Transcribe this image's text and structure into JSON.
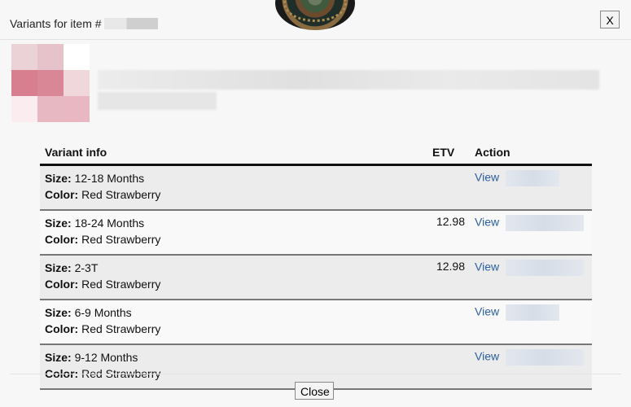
{
  "dialog": {
    "title": "Variants for item #",
    "close_x_label": "X",
    "close_label": "Close"
  },
  "table": {
    "headers": [
      "Variant info",
      "ETV",
      "Action"
    ],
    "size_label": "Size:",
    "color_label": "Color:",
    "rows": [
      {
        "size": "12-18 Months",
        "color": "Red Strawberry",
        "etv": "",
        "action": "View"
      },
      {
        "size": "18-24 Months",
        "color": "Red Strawberry",
        "etv": "12.98",
        "action": "View"
      },
      {
        "size": "2-3T",
        "color": "Red Strawberry",
        "etv": "12.98",
        "action": "View"
      },
      {
        "size": "6-9 Months",
        "color": "Red Strawberry",
        "etv": "",
        "action": "View"
      },
      {
        "size": "9-12 Months",
        "color": "Red Strawberry",
        "etv": "",
        "action": "View"
      }
    ]
  }
}
